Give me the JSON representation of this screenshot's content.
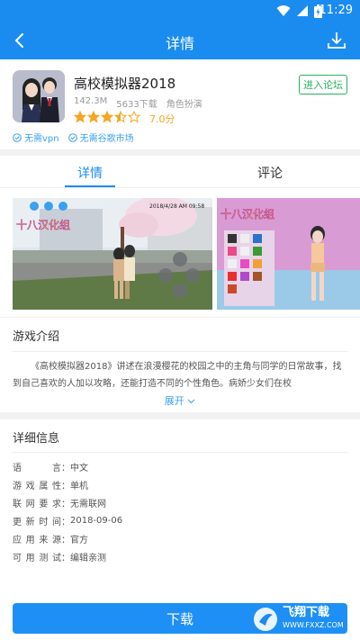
{
  "status_bar": {
    "time": "11:29"
  },
  "app_bar": {
    "title": "详情"
  },
  "app": {
    "name": "高校模拟器2018",
    "size": "142.3M",
    "downloads": "5633下载",
    "category": "角色扮演",
    "rating": "7.0分",
    "rating_value": 3.5,
    "rating_max": 5,
    "forum_button": "进入论坛",
    "tags": [
      "无需vpn",
      "无需谷歌市场"
    ]
  },
  "tabs": [
    {
      "label": "详情",
      "active": true
    },
    {
      "label": "评论",
      "active": false
    }
  ],
  "screenshots": {
    "shot1_timestamp": "2018/4/28 AM 09:58",
    "shot1_watermark": "十八汉化组",
    "shot2_watermark": "十八汉化组"
  },
  "intro": {
    "heading": "游戏介绍",
    "text": "《高校模拟器2018》讲述在浪漫樱花的校园之中的主角与同学的日常故事，找到自己喜欢的人加以攻略，还能打造不同的个性角色。病娇少女们在校",
    "expand": "展开"
  },
  "details": {
    "heading": "详细信息",
    "rows": [
      {
        "key": "语　　言",
        "value": "中文"
      },
      {
        "key": "游戏属性",
        "value": "单机"
      },
      {
        "key": "联网要求",
        "value": "无需联网"
      },
      {
        "key": "更新时间",
        "value": "2018-09-06"
      },
      {
        "key": "应用来源",
        "value": "官方"
      },
      {
        "key": "可用测试",
        "value": "编辑亲测"
      }
    ]
  },
  "download_button": "下载",
  "watermark": {
    "text": "飞翔下载",
    "url": "WWW.FXXZ.COM"
  },
  "colors": {
    "primary": "#1a8cf0",
    "forum_green": "#25b45e",
    "star": "#f5a623"
  }
}
